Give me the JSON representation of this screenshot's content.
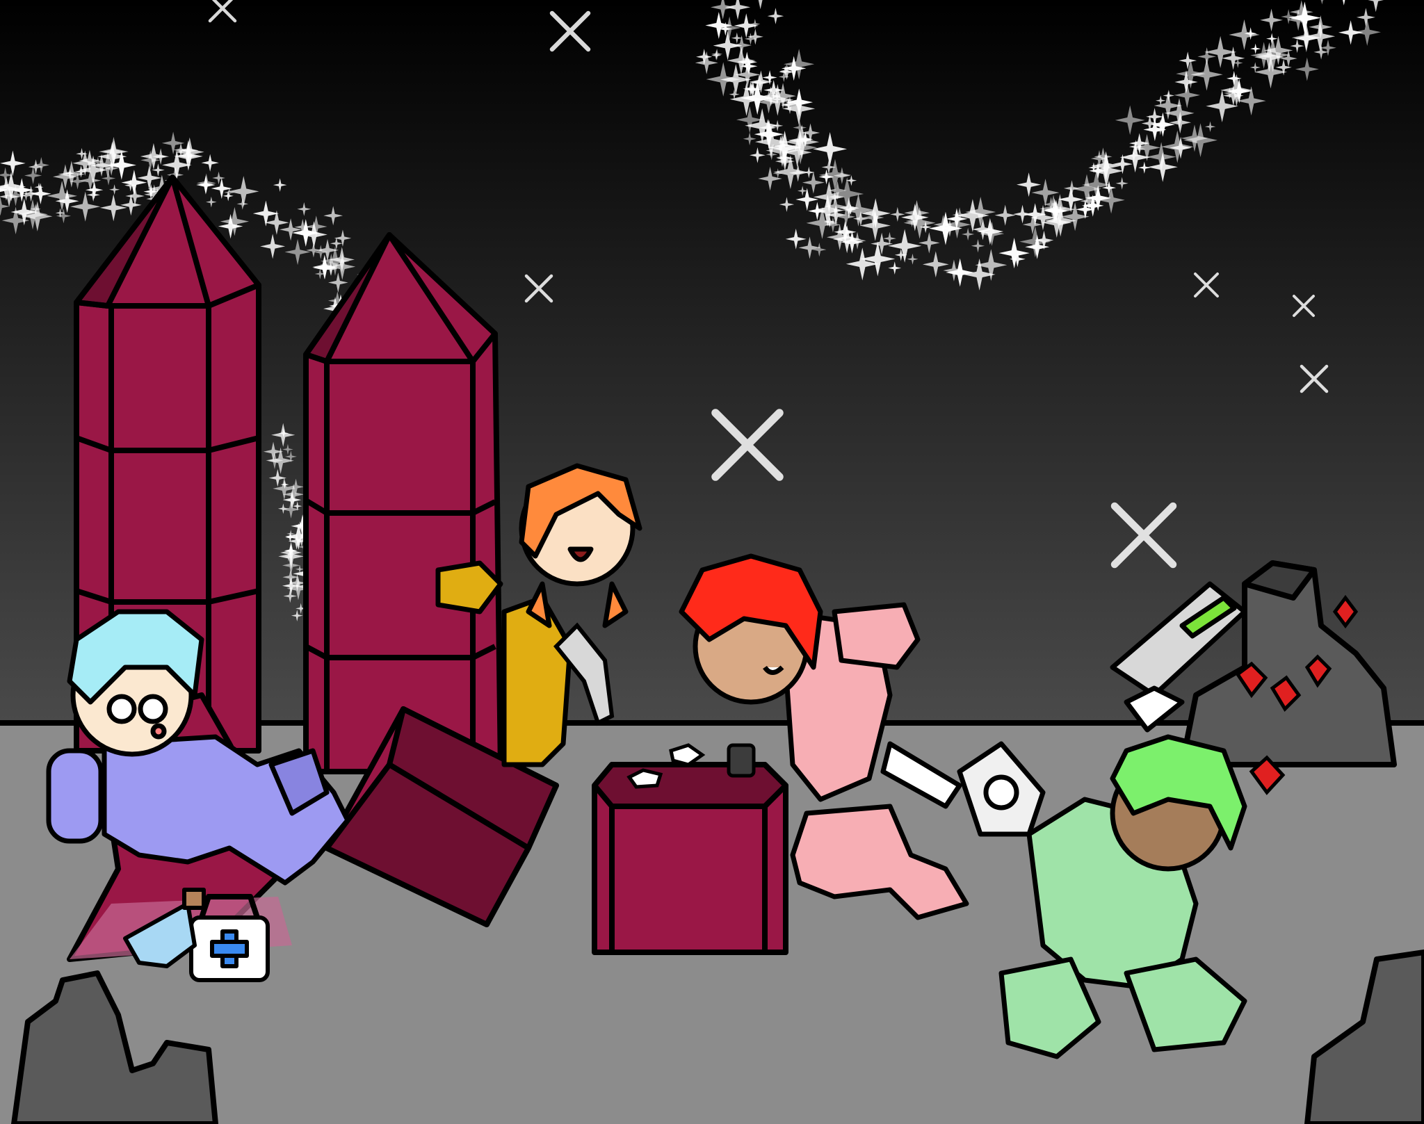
{
  "scene": {
    "colors": {
      "sky_top": "#000000",
      "sky_bottom": "#4a4a4a",
      "ground": "#8c8c8c",
      "ground_edge": "#000000",
      "crystal": "#9a1746",
      "crystal_dark": "#6e0f31",
      "rock": "#5a5a5a",
      "rock_dark": "#3c3c3c",
      "red_gem": "#e02020",
      "star": "#ffffff"
    },
    "characters": [
      {
        "name": "blue-astronaut",
        "suit": "#9d9af2",
        "hair": "#a6ecf6",
        "pose": "sitting"
      },
      {
        "name": "yellow-astronaut",
        "suit": "#e0ad12",
        "hair": "#ff8a3c",
        "pose": "peeking"
      },
      {
        "name": "pink-astronaut",
        "suit": "#f7aeb4",
        "hair": "#ff2a1a",
        "pose": "kicking"
      },
      {
        "name": "green-astronaut",
        "suit": "#9fe3a8",
        "hair": "#7cf06c",
        "pose": "sitting"
      }
    ],
    "items": [
      {
        "name": "first-aid-kit",
        "cross_color": "#3a8af0"
      },
      {
        "name": "potion-flask",
        "liquid_color": "#a8d8f4"
      },
      {
        "name": "chainsaw",
        "stripe_color": "#7ce33a"
      },
      {
        "name": "ray-gun",
        "color": "#d8d8d8"
      },
      {
        "name": "small-stone-pieces",
        "color": "#ffffff"
      }
    ]
  }
}
